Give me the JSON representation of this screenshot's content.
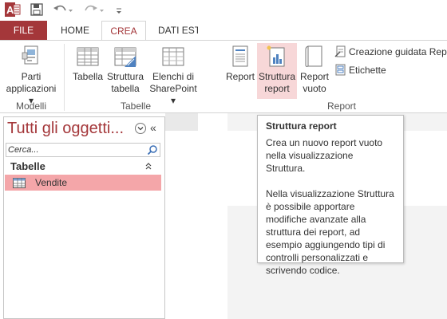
{
  "colors": {
    "accent": "#a4373a",
    "selection": "#f4a6a9",
    "highlight": "#f7d7d8"
  },
  "quick_access": {
    "app_icon": "access-logo-icon",
    "save_icon": "save-icon",
    "undo_icon": "undo-icon",
    "redo_icon": "redo-icon",
    "customize_icon": "customize-qat-icon"
  },
  "tabs": {
    "file": "FILE",
    "home": "HOME",
    "crea": "CREA",
    "dati": "DATI ESTI"
  },
  "ribbon": {
    "modelli": {
      "group_label": "Modelli",
      "parti_line1": "Parti",
      "parti_line2": "applicazioni"
    },
    "tabelle": {
      "group_label": "Tabelle",
      "tabella": "Tabella",
      "struttura_line1": "Struttura",
      "struttura_line2": "tabella",
      "elenchi_line1": "Elenchi di",
      "elenchi_line2": "SharePoint"
    },
    "report": {
      "group_label": "Report",
      "report": "Report",
      "struttura_line1": "Struttura",
      "struttura_line2": "report",
      "vuoto_line1": "Report",
      "vuoto_line2": "vuoto",
      "creazione_guidata": "Creazione guidata Repo",
      "etichette": "Etichette"
    }
  },
  "nav_pane": {
    "title": "Tutti gli oggetti...",
    "search_placeholder": "Cerca...",
    "section": "Tabelle",
    "items": [
      {
        "label": "Vendite"
      }
    ]
  },
  "tooltip": {
    "title": "Struttura report",
    "para1": "Crea un nuovo report vuoto nella visualizzazione Struttura.",
    "para2": "Nella visualizzazione Struttura è possibile apportare modifiche avanzate alla struttura dei report, ad esempio aggiungendo tipi di controlli personalizzati e scrivendo codice."
  }
}
